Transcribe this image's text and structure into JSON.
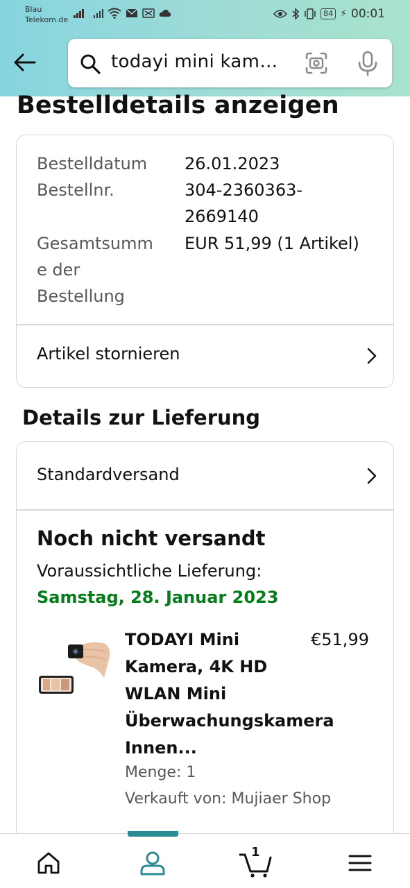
{
  "status_bar": {
    "carrier_line1": "Blau",
    "carrier_line2": "Telekom.de",
    "battery": "84",
    "time": "00:01"
  },
  "search": {
    "query": "todayi mini kam…",
    "icons": [
      "back-arrow-icon",
      "search-icon",
      "camera-scan-icon",
      "microphone-icon"
    ]
  },
  "page": {
    "title": "Bestelldetails anzeigen"
  },
  "order_summary": {
    "date_label": "Bestelldatum",
    "date_value": "26.01.2023",
    "number_label": "Bestellnr.",
    "number_value_line1": "304-2360363-",
    "number_value_line2": "2669140",
    "total_label_line1": "Gesamtsumm",
    "total_label_line2": "e der",
    "total_label_line3": "Bestellung",
    "total_value": "EUR 51,99 (1 Artikel)",
    "cancel_label": "Artikel stornieren"
  },
  "delivery": {
    "section_title": "Details zur Lieferung",
    "shipping_method": "Standardversand",
    "status_heading": "Noch nicht versandt",
    "expected_label": "Voraussichtliche Lieferung:",
    "expected_date": "Samstag, 28. Januar 2023",
    "product": {
      "title_line1": "TODAYI Mini",
      "title_line2": "Kamera, 4K HD",
      "title_line3": "WLAN Mini",
      "title_line4": "Überwachungskamera",
      "title_line5": "Innen...",
      "price": "€51,99",
      "quantity": "Menge: 1",
      "seller": "Verkauft von: Mujiaer Shop"
    }
  },
  "bottom_nav": {
    "items": [
      "home-icon",
      "account-icon",
      "cart-icon",
      "menu-icon"
    ],
    "cart_count": "1",
    "active": "account-icon"
  },
  "colors": {
    "accent_green": "#067d1a",
    "nav_indicator": "#2b8a93",
    "header_gradient_start": "#86d4df",
    "header_gradient_end": "#a8e3cb"
  }
}
